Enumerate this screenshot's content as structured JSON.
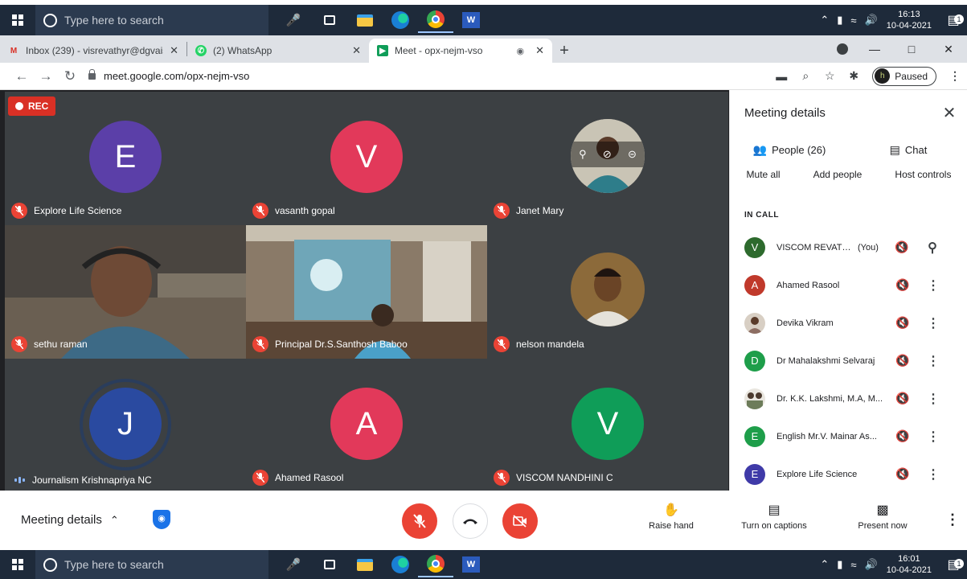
{
  "taskbar_top": {
    "search_placeholder": "Type here to search",
    "time": "16:13",
    "date": "10-04-2021",
    "notif_count": "1"
  },
  "taskbar_bottom": {
    "search_placeholder": "Type here to search",
    "time": "16:01",
    "date": "10-04-2021",
    "notif_count": "1"
  },
  "browser": {
    "tabs": [
      {
        "title": "Inbox (239) - visrevathyr@dgvais",
        "icon": "gmail-icon"
      },
      {
        "title": "(2) WhatsApp",
        "icon": "whatsapp-icon"
      },
      {
        "title": "Meet - opx-nejm-vso",
        "icon": "meet-icon"
      }
    ],
    "url": "meet.google.com/opx-nejm-vso",
    "profile_status": "Paused",
    "profile_initial": "h"
  },
  "rec_label": "REC",
  "tiles": [
    {
      "name": "Explore Life Science",
      "initial": "E",
      "color": "#5b3fa8"
    },
    {
      "name": "vasanth gopal",
      "initial": "V",
      "color": "#e2395a"
    },
    {
      "name": "Janet Mary",
      "initial": ""
    },
    {
      "name": "sethu raman",
      "initial": ""
    },
    {
      "name": "Principal Dr.S.Santhosh Baboo",
      "initial": ""
    },
    {
      "name": "nelson mandela",
      "initial": ""
    },
    {
      "name": "Journalism Krishnapriya NC",
      "initial": "J",
      "color": "#2a4aa0"
    },
    {
      "name": "Ahamed Rasool",
      "initial": "A",
      "color": "#e2395a"
    },
    {
      "name": "VISCOM NANDHINI C",
      "initial": "V",
      "color": "#0f9d58"
    }
  ],
  "panel": {
    "title": "Meeting details",
    "people_tab": "People (26)",
    "chat_tab": "Chat",
    "mute_all": "Mute all",
    "add_people": "Add people",
    "host_controls": "Host controls",
    "in_call_label": "IN CALL",
    "you_label": "(You)",
    "people": [
      {
        "name": "VISCOM REVATH...",
        "initial": "V",
        "color": "#2d6a2d"
      },
      {
        "name": "Ahamed Rasool",
        "initial": "A",
        "color": "#c0392b"
      },
      {
        "name": "Devika Vikram",
        "initial": "",
        "color": "#8d6e63"
      },
      {
        "name": "Dr Mahalakshmi Selvaraj",
        "initial": "D",
        "color": "#1e9e4a"
      },
      {
        "name": "Dr. K.K. Lakshmi, M.A, M...",
        "initial": "",
        "color": "#6d7c5a"
      },
      {
        "name": "English Mr.V. Mainar As...",
        "initial": "E",
        "color": "#1e9e4a"
      },
      {
        "name": "Explore Life Science",
        "initial": "E",
        "color": "#3f3aa8"
      }
    ]
  },
  "controls": {
    "meeting_details": "Meeting details",
    "raise_hand": "Raise hand",
    "captions": "Turn on captions",
    "present": "Present now"
  }
}
